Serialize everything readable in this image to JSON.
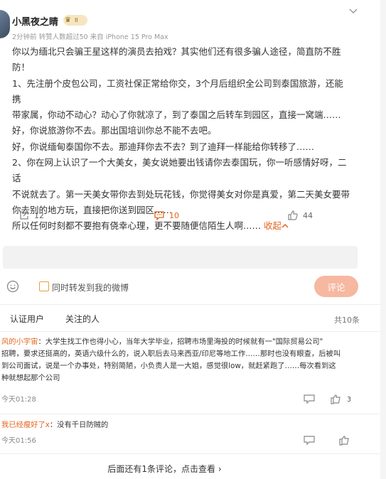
{
  "post": {
    "username": "小黑夜之睛",
    "badge_level": "II",
    "meta": "2分钟前 转赞人数超过50  来自 iPhone 15 Pro Max",
    "content_lines": [
      "你以为缅北只会骗王星这样的演员去拍戏？其实他们还有很多骗人途径，简直防不胜",
      "防！",
      "1、先注册个皮包公司，工资社保正常给你交，3个月后组织全公司到泰国旅游，还能携",
      "带家属，你动不动心？动心了你就凉了，到了泰国之后转车到园区，直接一窝端……",
      "好，你说旅游你不去。那出国培训你总不能不去吧。",
      "好，你说缅甸泰国你不去。那迪拜你去不去？到了迪拜一样能给你转移了……",
      "2、你在网上认识了一个大美女，美女说她要出钱请你去泰国玩，你一听感情好呀，二话",
      "不说就去了。第一天美女带你去到处玩花钱，你觉得美女对你是真爱，第二天美女要带",
      "你去别的地方玩，直接把你送到园区……",
      "所以任何时刻都不要抱有侥幸心理，更不要随便信陌生人啊……"
    ],
    "collapse_label": "收起",
    "repost_count": "12",
    "comment_count": "10",
    "like_count": "44"
  },
  "composer": {
    "repost_label": "同时转发到我的微博",
    "submit_label": "评论"
  },
  "tabs": {
    "verified": "认证用户",
    "following": "关注的人",
    "total": "共10条"
  },
  "comments": [
    {
      "user": "风的小宇宙",
      "text_lines": [
        "：大学生找工作也得小心，当年大学毕业，招聘市场里海投的时候就有一\"国际贸易公司\"",
        "招聘，要求还挺高的，英语六级什么的，说入职后去马来西亚/印尼等地工作……那时也没有眼查，后被叫",
        "到公司面试，说是一个办事处，特别简陋，小负责人是一大姐，感觉很low，就赶紧跑了……每次看到这",
        "种就想起那个公司"
      ],
      "time": "今天01:28",
      "likes": "3"
    },
    {
      "user": "我已经瘦好了x",
      "text_lines": [
        "：没有千日防贼的"
      ],
      "time": "今天01:56",
      "likes": ""
    }
  ],
  "more_label": "后面还有1条评论，点击查看 ›",
  "colors": {
    "accent": "#e5641b",
    "submit_bg": "#f6b8a0"
  }
}
